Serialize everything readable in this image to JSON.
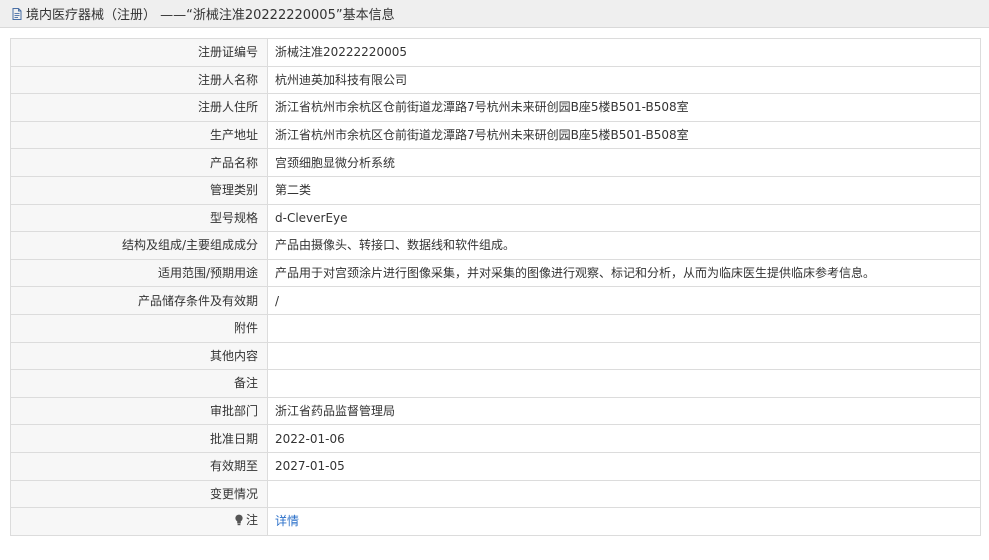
{
  "header": {
    "title": "境内医疗器械（注册） ——“浙械注准20222220005”基本信息",
    "icon": "document-icon"
  },
  "rows": [
    {
      "label": "注册证编号",
      "value": "浙械注准20222220005"
    },
    {
      "label": "注册人名称",
      "value": "杭州迪英加科技有限公司"
    },
    {
      "label": "注册人住所",
      "value": "浙江省杭州市余杭区仓前街道龙潭路7号杭州未来研创园B座5楼B501-B508室"
    },
    {
      "label": "生产地址",
      "value": "浙江省杭州市余杭区仓前街道龙潭路7号杭州未来研创园B座5楼B501-B508室"
    },
    {
      "label": "产品名称",
      "value": "宫颈细胞显微分析系统"
    },
    {
      "label": "管理类别",
      "value": "第二类"
    },
    {
      "label": "型号规格",
      "value": "d-CleverEye"
    },
    {
      "label": "结构及组成/主要组成成分",
      "value": "产品由摄像头、转接口、数据线和软件组成。"
    },
    {
      "label": "适用范围/预期用途",
      "value": "产品用于对宫颈涂片进行图像采集，并对采集的图像进行观察、标记和分析，从而为临床医生提供临床参考信息。"
    },
    {
      "label": "产品储存条件及有效期",
      "value": "/"
    },
    {
      "label": "附件",
      "value": ""
    },
    {
      "label": "其他内容",
      "value": ""
    },
    {
      "label": "备注",
      "value": ""
    },
    {
      "label": "审批部门",
      "value": "浙江省药品监督管理局"
    },
    {
      "label": "批准日期",
      "value": "2022-01-06"
    },
    {
      "label": "有效期至",
      "value": "2027-01-05"
    },
    {
      "label": "变更情况",
      "value": ""
    }
  ],
  "note": {
    "label": "注",
    "icon": "lightbulb-icon",
    "link_text": "详情"
  },
  "colors": {
    "label_bg": "#f7f7f7",
    "border": "#dcdcdc",
    "link": "#2a6fc9",
    "header_bg": "#efefef"
  }
}
